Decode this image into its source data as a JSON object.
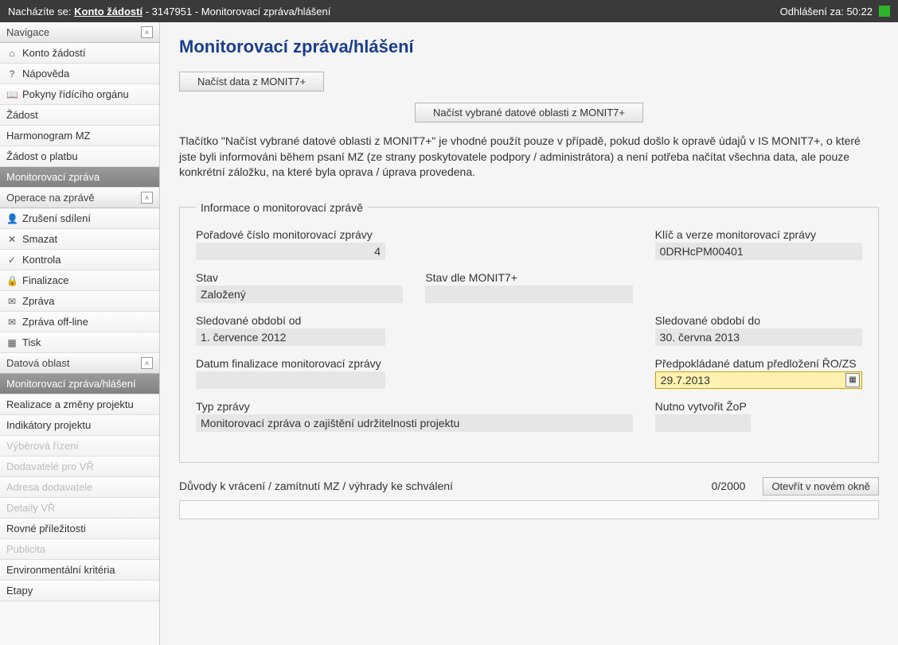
{
  "topbar": {
    "prefix": "Nacházíte se:",
    "link": "Konto žádostí",
    "suffix": " - 3147951 - Monitorovací zpráva/hlášení",
    "logout_label": "Odhlášení za:",
    "logout_time": "50:22"
  },
  "sidebar": {
    "sections": [
      {
        "title": "Navigace",
        "items": [
          {
            "label": "Konto žádostí",
            "icon": "⌂",
            "indent": true
          },
          {
            "label": "Nápověda",
            "icon": "?",
            "indent": true
          },
          {
            "label": "Pokyny řídícího orgánu",
            "icon": "📖",
            "indent": true
          },
          {
            "label": "Žádost"
          },
          {
            "label": "Harmonogram MZ"
          },
          {
            "label": "Žádost o platbu"
          },
          {
            "label": "Monitorovací zpráva",
            "active": true
          }
        ]
      },
      {
        "title": "Operace na zprávě",
        "items": [
          {
            "label": "Zrušení sdílení",
            "icon": "👤",
            "indent": true
          },
          {
            "label": "Smazat",
            "icon": "✕",
            "indent": true
          },
          {
            "label": "Kontrola",
            "icon": "✓",
            "indent": true
          },
          {
            "label": "Finalizace",
            "icon": "🔒",
            "indent": true
          },
          {
            "label": "Zpráva",
            "icon": "✉",
            "indent": true
          },
          {
            "label": "Zpráva off-line",
            "icon": "✉",
            "indent": true
          },
          {
            "label": "Tisk",
            "icon": "▦",
            "indent": true
          }
        ]
      },
      {
        "title": "Datová oblast",
        "items": [
          {
            "label": "Monitorovací zpráva/hlášení",
            "active": true
          },
          {
            "label": "Realizace a změny projektu"
          },
          {
            "label": "Indikátory projektu"
          },
          {
            "label": "Výběrová řízení",
            "disabled": true
          },
          {
            "label": "Dodavatelé pro VŘ",
            "disabled": true
          },
          {
            "label": "Adresa dodavatele",
            "disabled": true
          },
          {
            "label": "Detaily VŘ",
            "disabled": true
          },
          {
            "label": "Rovné příležitosti"
          },
          {
            "label": "Publicita",
            "disabled": true
          },
          {
            "label": "Environmentální kritéria"
          },
          {
            "label": "Etapy"
          }
        ]
      }
    ]
  },
  "main": {
    "title": "Monitorovací zpráva/hlášení",
    "btn_load": "Načíst data z MONIT7+",
    "btn_load_selected": "Načíst vybrané datové oblasti z MONIT7+",
    "info_text": "Tlačítko \"Načíst vybrané datové oblasti z MONIT7+\" je vhodné použít pouze v případě, pokud došlo k opravě údajů v IS MONIT7+, o které jste byli informováni během psaní MZ (ze strany poskytovatele podpory / administrátora) a není potřeba načítat všechna data, ale pouze konkrétní záložku, na které byla oprava / úprava provedena.",
    "fieldset_legend": "Informace o monitorovací zprávě",
    "fields": {
      "seq_label": "Pořadové číslo monitorovací zprávy",
      "seq_value": "4",
      "key_label": "Klíč a verze monitorovací zprávy",
      "key_value": "0DRHcPM00401",
      "state_label": "Stav",
      "state_value": "Založený",
      "state_monit_label": "Stav dle MONIT7+",
      "state_monit_value": "",
      "period_from_label": "Sledované období od",
      "period_from_value": "1. července 2012",
      "period_to_label": "Sledované období do",
      "period_to_value": "30. června 2013",
      "finalize_date_label": "Datum finalizace monitorovací zprávy",
      "finalize_date_value": "",
      "expected_date_label": "Předpokládané datum předložení ŘO/ZS",
      "expected_date_value": "29.7.2013",
      "type_label": "Typ zprávy",
      "type_value": "Monitorovací zpráva o zajištění udržitelnosti projektu",
      "zop_label": "Nutno vytvořit ŽoP",
      "zop_value": ""
    },
    "reasons_label": "Důvody k vrácení / zamítnutí MZ / výhrady ke schválení",
    "reasons_counter": "0/2000",
    "open_new_window": "Otevřít v novém okně"
  }
}
